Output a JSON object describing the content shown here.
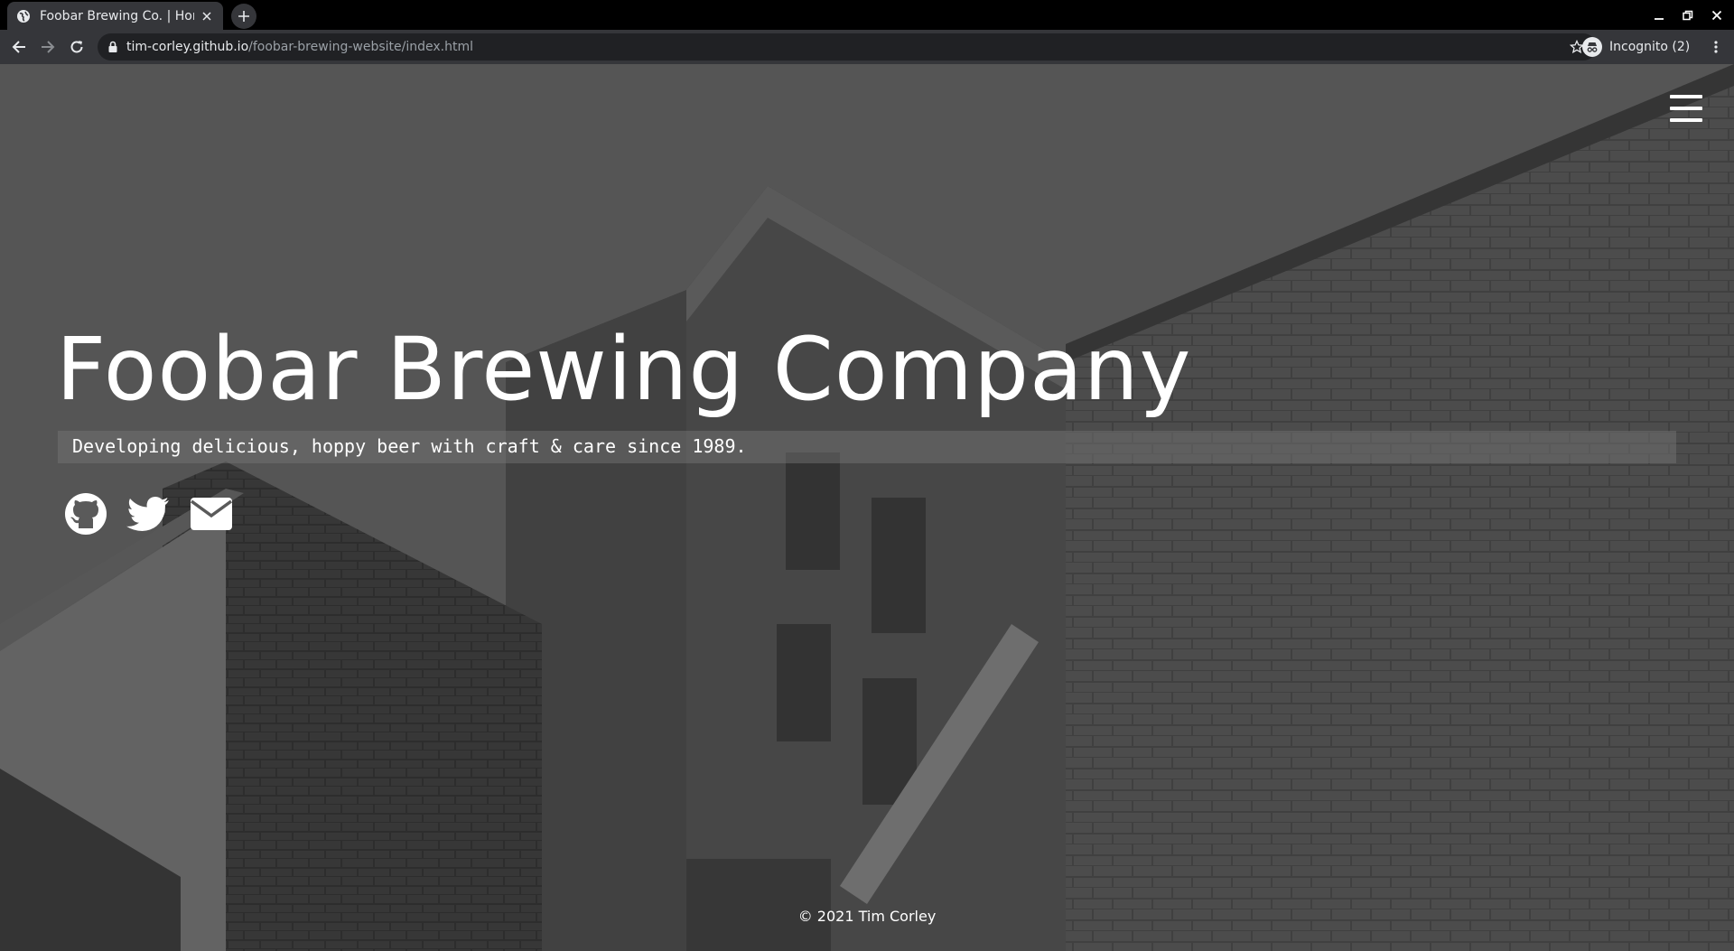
{
  "browser": {
    "tab": {
      "title": "Foobar Brewing Co. | Hom"
    },
    "url": {
      "host": "tim-corley.github.io",
      "path": "/foobar-brewing-website/index.html"
    },
    "profile": {
      "label": "Incognito (2)"
    }
  },
  "page": {
    "title": "Foobar Brewing Company",
    "tagline": "Developing delicious, hoppy beer with craft & care since 1989.",
    "social": [
      {
        "icon": "github-icon"
      },
      {
        "icon": "twitter-icon"
      },
      {
        "icon": "envelope-icon"
      }
    ],
    "footer": "© 2021 Tim Corley"
  },
  "colors": {
    "chrome_dark": "#000000",
    "chrome_tab": "#35363a",
    "omnibox": "#202124",
    "text_light": "#e8eaed",
    "page_text": "#ffffff"
  }
}
